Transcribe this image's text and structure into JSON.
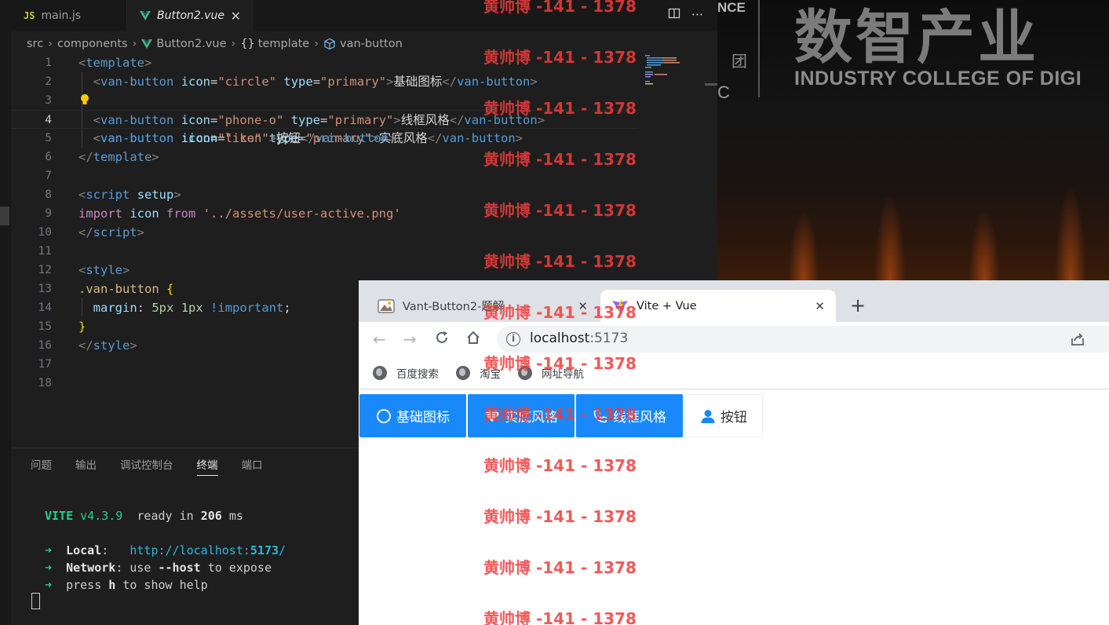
{
  "editor": {
    "tabs": [
      {
        "badge": "JS",
        "label": "main.js"
      },
      {
        "label": "Button2.vue",
        "close": "✕"
      }
    ],
    "tab_more": "···",
    "breadcrumb": [
      "src",
      "components",
      "Button2.vue",
      "template",
      "van-button"
    ],
    "breadcrumb_curly": "{}",
    "line_numbers": [
      "1",
      "2",
      "3",
      "4",
      "5",
      "6",
      "7",
      "8",
      "9",
      "10",
      "11",
      "12",
      "13",
      "14",
      "15",
      "16",
      "17",
      "18"
    ]
  },
  "panel": {
    "tabs": [
      "问题",
      "输出",
      "调试控制台",
      "终端",
      "端口"
    ]
  },
  "terminal": {
    "vite_name": "VITE",
    "vite_version": "v4.3.9",
    "ready_text": "ready in",
    "ready_ms": "206",
    "ready_unit": "ms",
    "arrow": "➜",
    "local_label": "Local",
    "local_url_prefix": "http://localhost:",
    "local_port": "5173",
    "local_url_suffix": "/",
    "network_label": "Network",
    "network_text_1": "use",
    "network_flag": "--host",
    "network_text_2": "to expose",
    "help_text_1": "press",
    "help_key": "h",
    "help_text_2": "to show help"
  },
  "background": {
    "corner_top": "NCE",
    "corner_mid": "团",
    "corner_bottom": "C",
    "big_text": "数智产业",
    "english_text": "INDUSTRY COLLEGE OF  DIGI"
  },
  "browser": {
    "tabs": [
      {
        "label": "Vant-Button2-题解",
        "close": "✕"
      },
      {
        "label": "Vite + Vue",
        "close": "✕"
      }
    ],
    "new_tab": "+",
    "url_host": "localhost",
    "url_port": ":5173",
    "bookmarks": [
      "百度搜索",
      "淘宝",
      "网址导航"
    ],
    "buttons": [
      {
        "label": "基础图标",
        "icon": "circle-icon",
        "type": "primary"
      },
      {
        "label": "实底风格",
        "icon": "like-icon",
        "type": "primary"
      },
      {
        "label": "线框风格",
        "icon": "phone-o-icon",
        "type": "primary"
      },
      {
        "label": "按钮",
        "icon": "user-avatar-icon",
        "type": "default"
      }
    ]
  },
  "watermark": "黄帅博 -141 - 1378",
  "colors": {
    "vant_primary": "#1989fa",
    "watermark": "#f03c3c",
    "vite_green": "#23d18b"
  }
}
